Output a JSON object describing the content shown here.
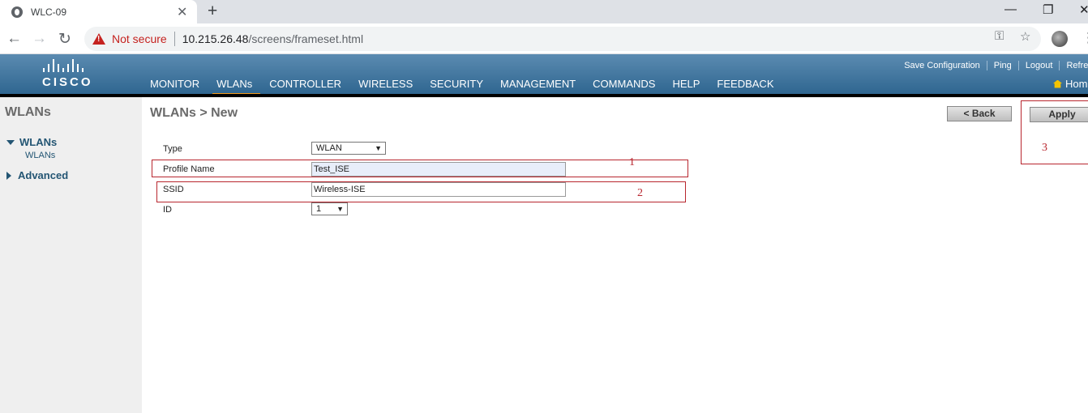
{
  "browser": {
    "tab_title": "WLC-09",
    "not_secure": "Not secure",
    "url_host": "10.215.26.48",
    "url_path": "/screens/frameset.html"
  },
  "header": {
    "top_links": [
      "Save Configuration",
      "Ping",
      "Logout",
      "Refresh"
    ],
    "nav": [
      "MONITOR",
      "WLANs",
      "CONTROLLER",
      "WIRELESS",
      "SECURITY",
      "MANAGEMENT",
      "COMMANDS",
      "HELP",
      "FEEDBACK"
    ],
    "active_nav": "WLANs",
    "home": "Home"
  },
  "sidebar": {
    "title": "WLANs",
    "groups": [
      {
        "label": "WLANs",
        "expanded": true,
        "items": [
          "WLANs"
        ]
      },
      {
        "label": "Advanced",
        "expanded": false,
        "items": []
      }
    ]
  },
  "page": {
    "title": "WLANs > New",
    "back_label": "< Back",
    "apply_label": "Apply",
    "form": {
      "type_label": "Type",
      "type_value": "WLAN",
      "profile_label": "Profile Name",
      "profile_value": "Test_ISE",
      "ssid_label": "SSID",
      "ssid_value": "Wireless-ISE",
      "id_label": "ID",
      "id_value": "1"
    },
    "annotations": [
      "1",
      "2",
      "3"
    ]
  }
}
